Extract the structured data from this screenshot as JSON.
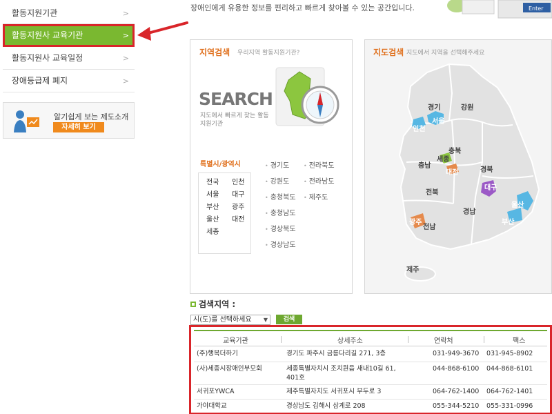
{
  "sidebar": {
    "items": [
      {
        "label": "활동지원기관"
      },
      {
        "label": "활동지원사 교육기관"
      },
      {
        "label": "활동지원사 교육일정"
      },
      {
        "label": "장애등급제 폐지"
      }
    ],
    "promo": {
      "text": "알기쉽게 보는 제도소개",
      "button": "자세히 보기"
    }
  },
  "intro": {
    "text": "장애인에게 유용한 정보를 편리하고 빠르게 찾아볼 수 있는 공간입니다.",
    "graphic_label": "Enter"
  },
  "region_search": {
    "title": "지역검색",
    "subtitle": "우리지역 활동지원기관?",
    "search_word": "SEARCH",
    "search_desc": "지도에서 빠르게 찾는 활동지원기관",
    "cities_title": "특별시/광역시",
    "cities": [
      "전국",
      "인천",
      "서울",
      "대구",
      "부산",
      "광주",
      "울산",
      "대전",
      "세종"
    ],
    "provinces_col1": [
      "경기도",
      "강원도",
      "충청북도",
      "충청남도",
      "경상북도",
      "경상남도"
    ],
    "provinces_col2": [
      "전라북도",
      "전라남도",
      "제주도"
    ]
  },
  "map_search": {
    "title": "지도검색",
    "subtitle": "지도에서 지역을 선택해주세요",
    "labels": {
      "gyeonggi": "경기",
      "gangwon": "강원",
      "seoul": "서울",
      "incheon": "인천",
      "chungbuk": "충북",
      "chungnam": "충남",
      "sejong": "세종",
      "daejeon": "대전",
      "gyeongbuk": "경북",
      "jeonbuk": "전북",
      "daegu": "대구",
      "ulsan": "울산",
      "gyeongnam": "경남",
      "busan": "부산",
      "gwangju": "광주",
      "jeonnam": "전남",
      "jeju": "제주"
    }
  },
  "search_bar": {
    "label": "검색지역 :",
    "select_value": "시(도)를 선택하세요",
    "button": "검색"
  },
  "table": {
    "headers": [
      "교육기관",
      "상세주소",
      "연락처",
      "팩스"
    ],
    "rows": [
      {
        "name": "(주)행복더하기",
        "address": "경기도 파주시 금릉다리길 271, 3층",
        "address2": "",
        "phone": "031-949-3670",
        "fax": "031-945-8902"
      },
      {
        "name": "(사)세종시장애인부모회",
        "address": "세종특별자치시 조치원읍 새내10길 61,",
        "address2": "401호",
        "phone": "044-868-6100",
        "fax": "044-868-6101"
      },
      {
        "name": "서귀포YWCA",
        "address": "제주특별자치도 서귀포시 부두로 3",
        "address2": "",
        "phone": "064-762-1400",
        "fax": "064-762-1401"
      },
      {
        "name": "가야대학교",
        "address": "경상남도 김해시 삼계로 208",
        "address2": "",
        "phone": "055-344-5210",
        "fax": "055-331-0996"
      }
    ]
  },
  "colors": {
    "accent_green": "#7ab830",
    "accent_orange": "#e0701d",
    "highlight_red": "#d9252a"
  }
}
